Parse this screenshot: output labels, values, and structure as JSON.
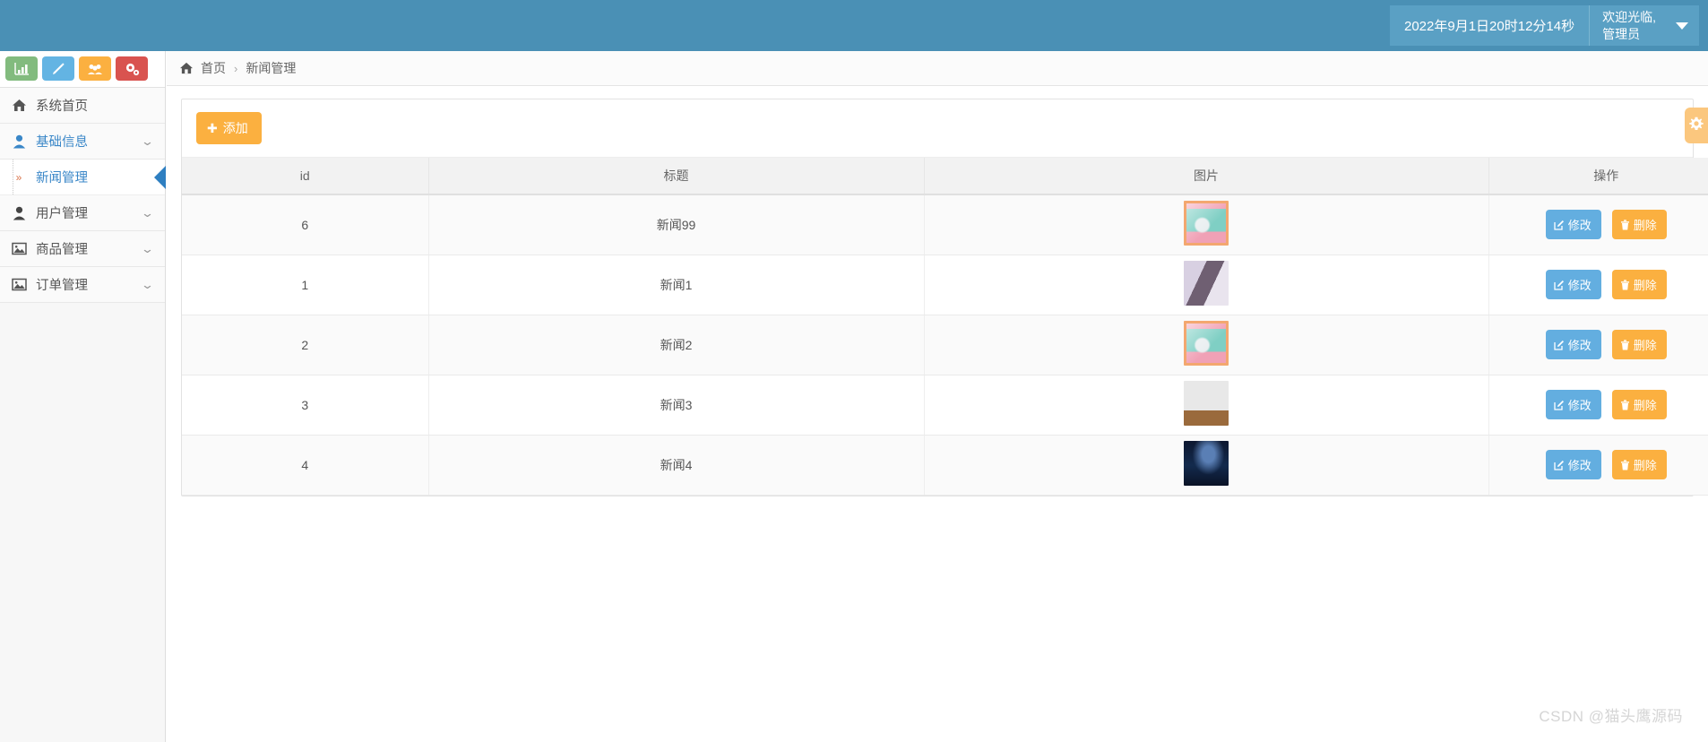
{
  "header": {
    "datetime": "2022年9月1日20时12分14秒",
    "welcome_line1": "欢迎光临,",
    "welcome_line2": "管理员",
    "caret_icon": "chevron-down-icon"
  },
  "sidebar": {
    "quick_actions": [
      {
        "name": "chart-icon",
        "color": "#82bb7e"
      },
      {
        "name": "pencil-icon",
        "color": "#63b4e3"
      },
      {
        "name": "users-icon",
        "color": "#fbb040"
      },
      {
        "name": "gears-icon",
        "color": "#d9534f"
      }
    ],
    "items": [
      {
        "label": "系统首页",
        "icon": "home-icon",
        "expandable": false,
        "active": false
      },
      {
        "label": "基础信息",
        "icon": "user-blue-icon",
        "expandable": true,
        "active": true
      },
      {
        "label": "用户管理",
        "icon": "user-dark-icon",
        "expandable": true,
        "active": false
      },
      {
        "label": "商品管理",
        "icon": "image-icon",
        "expandable": true,
        "active": false
      },
      {
        "label": "订单管理",
        "icon": "image-icon",
        "expandable": true,
        "active": false
      }
    ],
    "sub_item": {
      "label": "新闻管理",
      "icon": "double-angle-right-icon",
      "active": true
    }
  },
  "breadcrumb": {
    "home_icon": "home-icon",
    "home": "首页",
    "separator": "›",
    "current": "新闻管理"
  },
  "toolbar": {
    "add_label": "添加",
    "add_icon": "plus-icon"
  },
  "table": {
    "columns": [
      "id",
      "标题",
      "图片",
      "操作"
    ],
    "rows": [
      {
        "id": "6",
        "title": "新闻99",
        "thumb": "thumb-poster",
        "edit": "修改",
        "delete": "删除"
      },
      {
        "id": "1",
        "title": "新闻1",
        "thumb": "thumb-portrait",
        "edit": "修改",
        "delete": "删除"
      },
      {
        "id": "2",
        "title": "新闻2",
        "thumb": "thumb-poster",
        "edit": "修改",
        "delete": "删除"
      },
      {
        "id": "3",
        "title": "新闻3",
        "thumb": "thumb-stage",
        "edit": "修改",
        "delete": "删除"
      },
      {
        "id": "4",
        "title": "新闻4",
        "thumb": "thumb-night",
        "edit": "修改",
        "delete": "删除"
      }
    ]
  },
  "settings_tab": {
    "icon": "gear-icon"
  },
  "watermark": "CSDN @猫头鹰源码",
  "colors": {
    "topbar": "#4a90b5",
    "accent_blue": "#3a87c8",
    "accent_orange": "#fbb040",
    "edit_blue": "#63aee0"
  }
}
